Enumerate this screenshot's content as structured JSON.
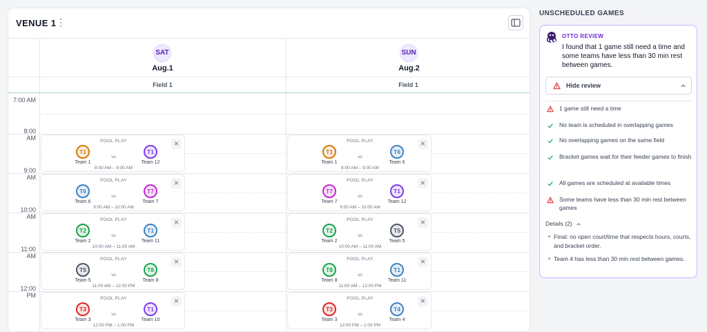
{
  "venue": {
    "title": "VENUE 1",
    "menu_icon": "kebab-icon",
    "sidebar_icon": "panel-toggle-icon"
  },
  "days": [
    {
      "abbr": "SAT",
      "date": "Aug.1",
      "field": "Field 1"
    },
    {
      "abbr": "SUN",
      "date": "Aug.2",
      "field": "Field 1"
    }
  ],
  "time_labels": [
    "7:00 AM",
    "8:00 AM",
    "9:00 AM",
    "10:00 AM",
    "11:00 AM",
    "12:00 PM"
  ],
  "badge_colors": {
    "orange": "#d97706",
    "purple": "#7c3aed",
    "blue": "#3b82c4",
    "pink": "#c026d3",
    "green": "#16a34a",
    "gray": "#4b5563",
    "red": "#dc2626"
  },
  "games": {
    "sat": [
      {
        "label": "POOL PLAY",
        "vs": "vs",
        "time": "8:00 AM – 9:00 AM",
        "home": {
          "code": "T1",
          "name": "Team 1",
          "color": "orange"
        },
        "away": {
          "code": "T1",
          "name": "Team 12",
          "color": "purple"
        }
      },
      {
        "label": "POOL PLAY",
        "vs": "vs",
        "time": "9:00 AM – 10:00 AM",
        "home": {
          "code": "T6",
          "name": "Team 6",
          "color": "blue"
        },
        "away": {
          "code": "T7",
          "name": "Team 7",
          "color": "pink"
        }
      },
      {
        "label": "POOL PLAY",
        "vs": "vs",
        "time": "10:00 AM – 11:00 AM",
        "home": {
          "code": "T2",
          "name": "Team 2",
          "color": "green"
        },
        "away": {
          "code": "T1",
          "name": "Team 11",
          "color": "blue"
        }
      },
      {
        "label": "POOL PLAY",
        "vs": "vs",
        "time": "11:00 AM – 12:00 PM",
        "home": {
          "code": "T5",
          "name": "Team 5",
          "color": "gray"
        },
        "away": {
          "code": "T8",
          "name": "Team 8",
          "color": "green"
        }
      },
      {
        "label": "POOL PLAY",
        "vs": "vs",
        "time": "12:00 PM – 1:00 PM",
        "home": {
          "code": "T3",
          "name": "Team 3",
          "color": "red"
        },
        "away": {
          "code": "T1",
          "name": "Team 10",
          "color": "purple"
        }
      }
    ],
    "sun": [
      {
        "label": "POOL PLAY",
        "vs": "vs",
        "time": "8:00 AM – 9:00 AM",
        "home": {
          "code": "T1",
          "name": "Team 1",
          "color": "orange"
        },
        "away": {
          "code": "T6",
          "name": "Team 6",
          "color": "blue"
        }
      },
      {
        "label": "POOL PLAY",
        "vs": "vs",
        "time": "9:00 AM – 10:00 AM",
        "home": {
          "code": "T7",
          "name": "Team 7",
          "color": "pink"
        },
        "away": {
          "code": "T1",
          "name": "Team 12",
          "color": "purple"
        }
      },
      {
        "label": "POOL PLAY",
        "vs": "vs",
        "time": "10:00 AM – 11:00 AM",
        "home": {
          "code": "T2",
          "name": "Team 2",
          "color": "green"
        },
        "away": {
          "code": "T5",
          "name": "Team 5",
          "color": "gray"
        }
      },
      {
        "label": "POOL PLAY",
        "vs": "vs",
        "time": "11:00 AM – 12:00 PM",
        "home": {
          "code": "T8",
          "name": "Team 8",
          "color": "green"
        },
        "away": {
          "code": "T1",
          "name": "Team 11",
          "color": "blue"
        }
      },
      {
        "label": "POOL PLAY",
        "vs": "vs",
        "time": "12:00 PM – 1:00 PM",
        "home": {
          "code": "T3",
          "name": "Team 3",
          "color": "red"
        },
        "away": {
          "code": "T4",
          "name": "Team 4",
          "color": "blue"
        }
      }
    ]
  },
  "review": {
    "section_title": "UNSCHEDULED GAMES",
    "label": "OTTO REVIEW",
    "message": "I found that 1 game still need a time and some teams have less than 30 min rest between games.",
    "hide_button": "Hide review",
    "checks": [
      {
        "status": "warning",
        "text": "1 game still need a time"
      },
      {
        "status": "ok",
        "text": "No team is scheduled in overlapping games"
      },
      {
        "status": "ok",
        "text": "No overlapping games on the same field"
      },
      {
        "status": "ok",
        "text": "Bracket games wait for their feeder games to finish"
      },
      {
        "status": "ok",
        "text": "All games are scheduled at available times"
      },
      {
        "status": "warning",
        "text": "Some teams have less than 30 min rest between games"
      }
    ],
    "details_label": "Details (2)",
    "details": [
      "Final: no open court/time that respects hours, courts, and bracket order.",
      "Team 4 has less than 30 min rest between games."
    ],
    "colors": {
      "warning": "#dc2626",
      "ok": "#16a34a",
      "accent": "#6d28d9"
    }
  }
}
